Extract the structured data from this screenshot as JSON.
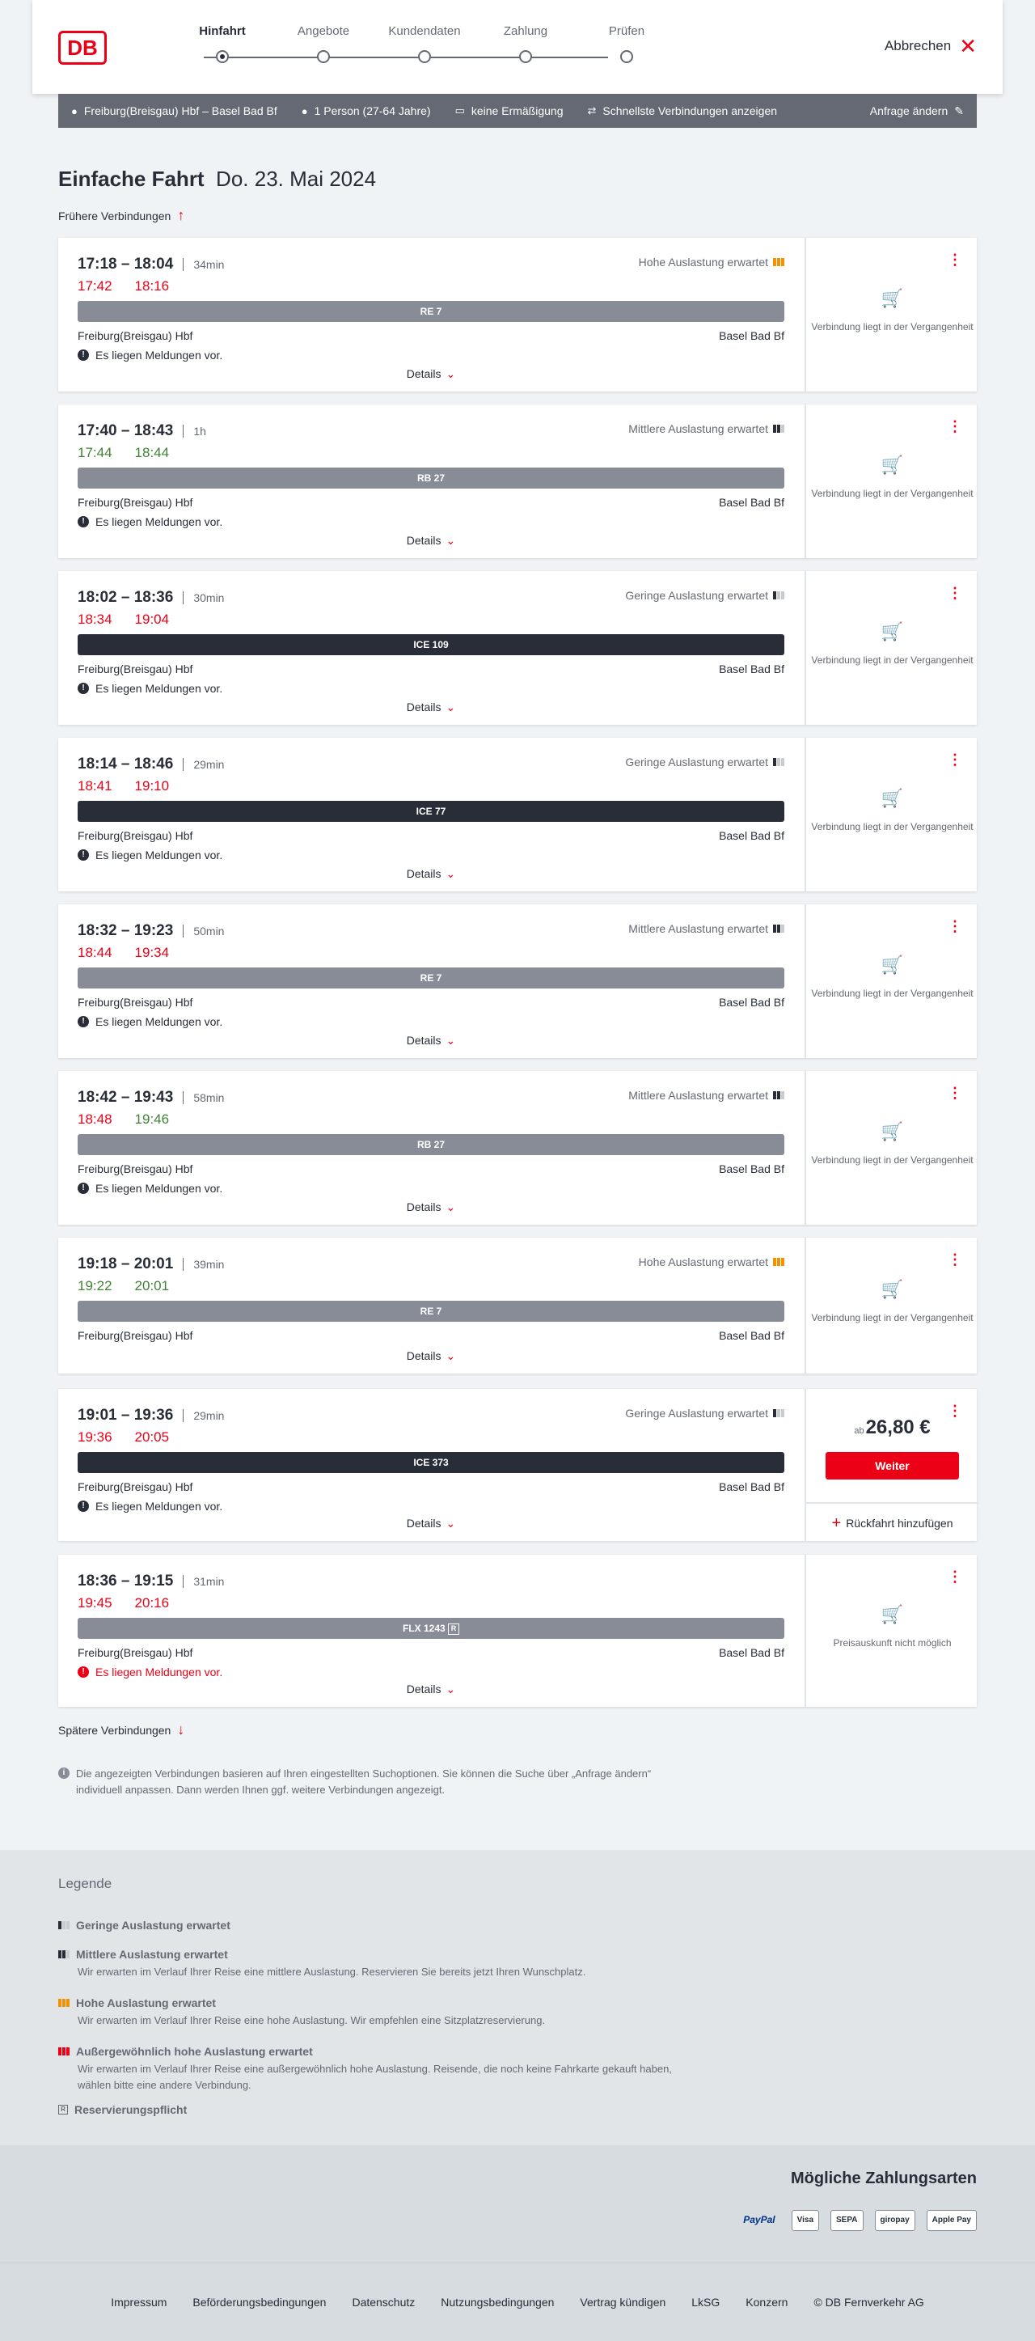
{
  "header": {
    "logo": "DB",
    "steps": [
      {
        "label": "Hinfahrt",
        "active": true
      },
      {
        "label": "Angebote",
        "active": false
      },
      {
        "label": "Kundendaten",
        "active": false
      },
      {
        "label": "Zahlung",
        "active": false
      },
      {
        "label": "Prüfen",
        "active": false
      }
    ],
    "cancel_label": "Abbrechen"
  },
  "summary": {
    "route": "Freiburg(Breisgau) Hbf – Basel Bad Bf",
    "persons": "1 Person (27-64 Jahre)",
    "discount": "keine Ermäßigung",
    "fastest": "Schnellste Verbindungen anzeigen",
    "change": "Anfrage ändern"
  },
  "heading": {
    "type": "Einfache Fahrt",
    "date": "Do. 23. Mai 2024"
  },
  "earlier_label": "Frühere Verbindungen",
  "later_label": "Spätere Verbindungen",
  "details_label": "Details",
  "past_label": "Verbindung liegt in der Vergangenheit",
  "connections": [
    {
      "times": "17:18 – 18:04",
      "duration": "34min",
      "rt_dep": "17:42",
      "rt_arr": "18:16",
      "rt_dep_color": "red",
      "rt_arr_color": "red",
      "load": "Hohe Auslastung erwartet",
      "load_level": "high",
      "train": "RE 7",
      "train_style": "grey",
      "from": "Freiburg(Breisgau) Hbf",
      "to": "Basel Bad Bf",
      "notice": "Es liegen Meldungen vor.",
      "side": "past"
    },
    {
      "times": "17:40 – 18:43",
      "duration": "1h",
      "rt_dep": "17:44",
      "rt_arr": "18:44",
      "rt_dep_color": "green",
      "rt_arr_color": "green",
      "load": "Mittlere Auslastung erwartet",
      "load_level": "medium",
      "train": "RB 27",
      "train_style": "grey",
      "from": "Freiburg(Breisgau) Hbf",
      "to": "Basel Bad Bf",
      "notice": "Es liegen Meldungen vor.",
      "side": "past"
    },
    {
      "times": "18:02 – 18:36",
      "duration": "30min",
      "rt_dep": "18:34",
      "rt_arr": "19:04",
      "rt_dep_color": "red",
      "rt_arr_color": "red",
      "load": "Geringe Auslastung erwartet",
      "load_level": "low",
      "train": "ICE 109",
      "train_style": "dark",
      "from": "Freiburg(Breisgau) Hbf",
      "to": "Basel Bad Bf",
      "notice": "Es liegen Meldungen vor.",
      "side": "past"
    },
    {
      "times": "18:14 – 18:46",
      "duration": "29min",
      "rt_dep": "18:41",
      "rt_arr": "19:10",
      "rt_dep_color": "red",
      "rt_arr_color": "red",
      "load": "Geringe Auslastung erwartet",
      "load_level": "low",
      "train": "ICE 77",
      "train_style": "dark",
      "from": "Freiburg(Breisgau) Hbf",
      "to": "Basel Bad Bf",
      "notice": "Es liegen Meldungen vor.",
      "side": "past"
    },
    {
      "times": "18:32 – 19:23",
      "duration": "50min",
      "rt_dep": "18:44",
      "rt_arr": "19:34",
      "rt_dep_color": "red",
      "rt_arr_color": "red",
      "load": "Mittlere Auslastung erwartet",
      "load_level": "medium",
      "train": "RE 7",
      "train_style": "grey",
      "from": "Freiburg(Breisgau) Hbf",
      "to": "Basel Bad Bf",
      "notice": "Es liegen Meldungen vor.",
      "side": "past"
    },
    {
      "times": "18:42 – 19:43",
      "duration": "58min",
      "rt_dep": "18:48",
      "rt_arr": "19:46",
      "rt_dep_color": "red",
      "rt_arr_color": "green",
      "load": "Mittlere Auslastung erwartet",
      "load_level": "medium",
      "train": "RB 27",
      "train_style": "grey",
      "from": "Freiburg(Breisgau) Hbf",
      "to": "Basel Bad Bf",
      "notice": "Es liegen Meldungen vor.",
      "side": "past"
    },
    {
      "times": "19:18 – 20:01",
      "duration": "39min",
      "rt_dep": "19:22",
      "rt_arr": "20:01",
      "rt_dep_color": "green",
      "rt_arr_color": "green",
      "load": "Hohe Auslastung erwartet",
      "load_level": "high",
      "train": "RE 7",
      "train_style": "grey",
      "from": "Freiburg(Breisgau) Hbf",
      "to": "Basel Bad Bf",
      "notice": "",
      "side": "past"
    },
    {
      "times": "19:01 – 19:36",
      "duration": "29min",
      "rt_dep": "19:36",
      "rt_arr": "20:05",
      "rt_dep_color": "red",
      "rt_arr_color": "red",
      "load": "Geringe Auslastung erwartet",
      "load_level": "low",
      "train": "ICE 373",
      "train_style": "dark",
      "from": "Freiburg(Breisgau) Hbf",
      "to": "Basel Bad Bf",
      "notice": "Es liegen Meldungen vor.",
      "side": "price",
      "price_prefix": "ab",
      "price": "26,80 €",
      "button": "Weiter",
      "return_label": "Rückfahrt hinzufügen"
    },
    {
      "times": "18:36 – 19:15",
      "duration": "31min",
      "rt_dep": "19:45",
      "rt_arr": "20:16",
      "rt_dep_color": "red",
      "rt_arr_color": "red",
      "load": "",
      "load_level": "",
      "train": "FLX 1243",
      "train_style": "grey",
      "from": "Freiburg(Breisgau) Hbf",
      "to": "Basel Bad Bf",
      "notice": "Es liegen Meldungen vor.",
      "notice_red": true,
      "side": "noprice",
      "side_text": "Preisauskunft nicht möglich"
    }
  ],
  "info_text": "Die angezeigten Verbindungen basieren auf Ihren eingestellten Suchoptionen. Sie können die Suche über „Anfrage ändern“ individuell anpassen. Dann werden Ihnen ggf. weitere Verbindungen angezeigt.",
  "legend": {
    "title": "Legende",
    "items": [
      {
        "title": "Geringe Auslastung erwartet",
        "desc": ""
      },
      {
        "title": "Mittlere Auslastung erwartet",
        "desc": "Wir erwarten im Verlauf Ihrer Reise eine mittlere Auslastung. Reservieren Sie bereits jetzt Ihren Wunschplatz."
      },
      {
        "title": "Hohe Auslastung erwartet",
        "desc": "Wir erwarten im Verlauf Ihrer Reise eine hohe Auslastung. Wir empfehlen eine Sitzplatzreservierung."
      },
      {
        "title": "Außergewöhnlich hohe Auslastung erwartet",
        "desc": "Wir erwarten im Verlauf Ihrer Reise eine außergewöhnlich hohe Auslastung. Reisende, die noch keine Fahrkarte gekauft haben, wählen bitte eine andere Verbindung."
      },
      {
        "title": "Reservierungspflicht",
        "desc": ""
      }
    ]
  },
  "payment": {
    "title": "Mögliche Zahlungsarten",
    "methods": [
      "PayPal",
      "Visa",
      "SEPA",
      "giropay",
      "Apple Pay"
    ]
  },
  "footer": {
    "links": [
      "Impressum",
      "Beförderungsbedingungen",
      "Datenschutz",
      "Nutzungsbedingungen",
      "Vertrag kündigen",
      "LkSG",
      "Konzern",
      "© DB Fernverkehr AG"
    ]
  },
  "colors": {
    "db_red": "#ec0016",
    "delay_red": "#ec0016",
    "ontime_green": "#408335",
    "high_load": "#f39200"
  }
}
